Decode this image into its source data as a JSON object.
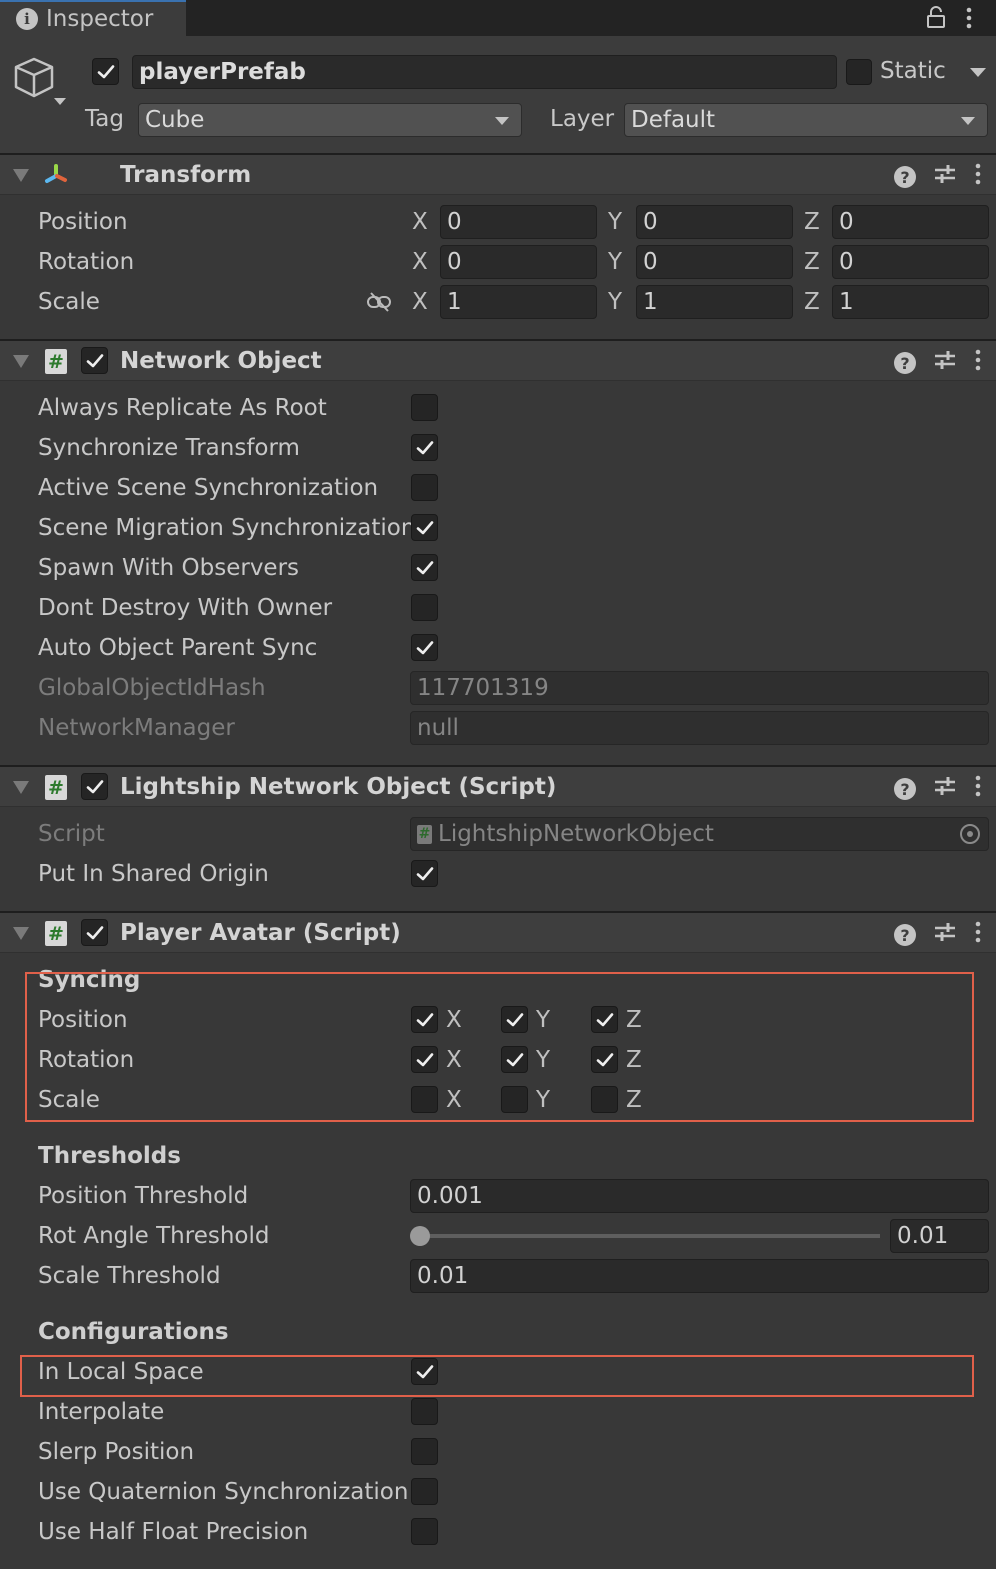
{
  "tab": {
    "title": "Inspector",
    "icon": "info-icon"
  },
  "object": {
    "active": true,
    "name": "playerPrefab",
    "static_label": "Static",
    "static": false,
    "tag_label": "Tag",
    "tag": "Cube",
    "layer_label": "Layer",
    "layer": "Default"
  },
  "colors": {
    "highlight": "#e0604a",
    "background": "#383838",
    "field": "#2a2a2a",
    "accent_tab": "#3a72b0"
  },
  "sections": [
    {
      "id": "transform",
      "title": "Transform",
      "icon": "transform-icon",
      "has_toggle": false,
      "rows": [
        {
          "type": "vector3",
          "label": "Position",
          "values": [
            "0",
            "0",
            "0"
          ]
        },
        {
          "type": "vector3",
          "label": "Rotation",
          "values": [
            "0",
            "0",
            "0"
          ]
        },
        {
          "type": "vector3",
          "label": "Scale",
          "values": [
            "1",
            "1",
            "1"
          ],
          "icon": "constrain-proportions-icon"
        }
      ]
    },
    {
      "id": "network-object",
      "title": "Network Object",
      "icon": "script-icon",
      "has_toggle": true,
      "enabled": true,
      "rows": [
        {
          "type": "toggle",
          "label": "Always Replicate As Root",
          "checked": false
        },
        {
          "type": "toggle",
          "label": "Synchronize Transform",
          "checked": true
        },
        {
          "type": "toggle",
          "label": "Active Scene Synchronization",
          "checked": false
        },
        {
          "type": "toggle",
          "label": "Scene Migration Synchronization",
          "checked": true
        },
        {
          "type": "toggle",
          "label": "Spawn With Observers",
          "checked": true
        },
        {
          "type": "toggle",
          "label": "Dont Destroy With Owner",
          "checked": false
        },
        {
          "type": "toggle",
          "label": "Auto Object Parent Sync",
          "checked": true
        },
        {
          "type": "readonly",
          "label": "GlobalObjectIdHash",
          "value": "117701319"
        },
        {
          "type": "readonly",
          "label": "NetworkManager",
          "value": "null"
        }
      ]
    },
    {
      "id": "lightship-network-object",
      "title": "Lightship Network Object (Script)",
      "icon": "script-icon",
      "has_toggle": true,
      "enabled": true,
      "rows": [
        {
          "type": "object",
          "label": "Script",
          "value": "LightshipNetworkObject"
        },
        {
          "type": "toggle",
          "label": "Put In Shared Origin",
          "checked": true
        }
      ]
    },
    {
      "id": "player-avatar",
      "title": "Player Avatar (Script)",
      "icon": "script-icon",
      "has_toggle": true,
      "enabled": true,
      "rows": [
        {
          "type": "heading",
          "label": "Syncing"
        },
        {
          "type": "toggle3",
          "label": "Position",
          "letters": [
            "X",
            "Y",
            "Z"
          ],
          "checked": [
            true,
            true,
            true
          ]
        },
        {
          "type": "toggle3",
          "label": "Rotation",
          "letters": [
            "X",
            "Y",
            "Z"
          ],
          "checked": [
            true,
            true,
            true
          ]
        },
        {
          "type": "toggle3",
          "label": "Scale",
          "letters": [
            "X",
            "Y",
            "Z"
          ],
          "checked": [
            false,
            false,
            false
          ]
        },
        {
          "type": "heading",
          "label": "Thresholds",
          "gap": true
        },
        {
          "type": "float",
          "label": "Position Threshold",
          "value": "0.001"
        },
        {
          "type": "slider",
          "label": "Rot Angle Threshold",
          "value": "0.01",
          "slider_fraction": 0
        },
        {
          "type": "float",
          "label": "Scale Threshold",
          "value": "0.01"
        },
        {
          "type": "heading",
          "label": "Configurations",
          "gap": true
        },
        {
          "type": "toggle",
          "label": "In Local Space",
          "checked": true
        },
        {
          "type": "toggle",
          "label": "Interpolate",
          "checked": false
        },
        {
          "type": "toggle",
          "label": "Slerp Position",
          "checked": false
        },
        {
          "type": "toggle",
          "label": "Use Quaternion Synchronization",
          "checked": false
        },
        {
          "type": "toggle",
          "label": "Use Half Float Precision",
          "checked": false
        }
      ]
    }
  ]
}
